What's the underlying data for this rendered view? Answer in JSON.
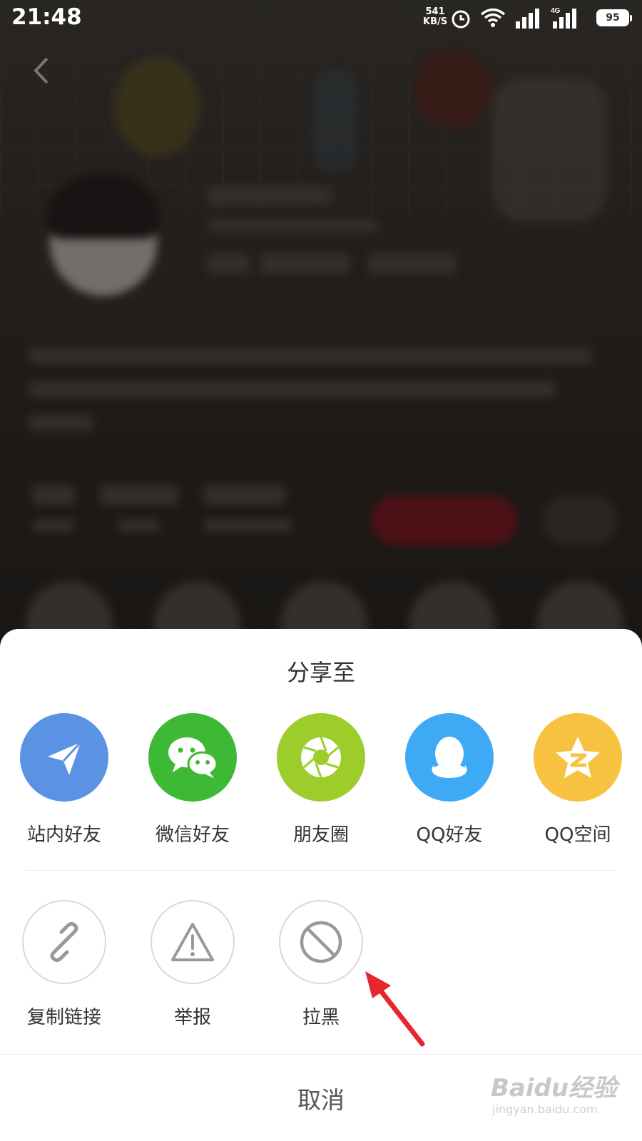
{
  "status_bar": {
    "time": "21:48",
    "net_speed_value": "541",
    "net_speed_unit": "KB/S",
    "battery": "95",
    "icons": [
      "alarm-icon",
      "wifi-icon",
      "signal-icon",
      "signal-4g-icon"
    ]
  },
  "share_sheet": {
    "title": "分享至",
    "share_targets": [
      {
        "label": "站内好友",
        "icon": "send-icon",
        "color": "#5b93e4"
      },
      {
        "label": "微信好友",
        "icon": "wechat-icon",
        "color": "#3eb935"
      },
      {
        "label": "朋友圈",
        "icon": "moments-icon",
        "color": "#9dcd2b"
      },
      {
        "label": "QQ好友",
        "icon": "qq-icon",
        "color": "#3eaaf5"
      },
      {
        "label": "QQ空间",
        "icon": "qzone-icon",
        "color": "#f6c240"
      }
    ],
    "actions": [
      {
        "label": "复制链接",
        "icon": "link-icon"
      },
      {
        "label": "举报",
        "icon": "warning-icon"
      },
      {
        "label": "拉黑",
        "icon": "block-icon"
      }
    ],
    "cancel_label": "取消"
  },
  "annotation": {
    "arrow_color": "#e8262d"
  },
  "watermark": {
    "brand": "Baidu经验",
    "url": "jingyan.baidu.com"
  }
}
